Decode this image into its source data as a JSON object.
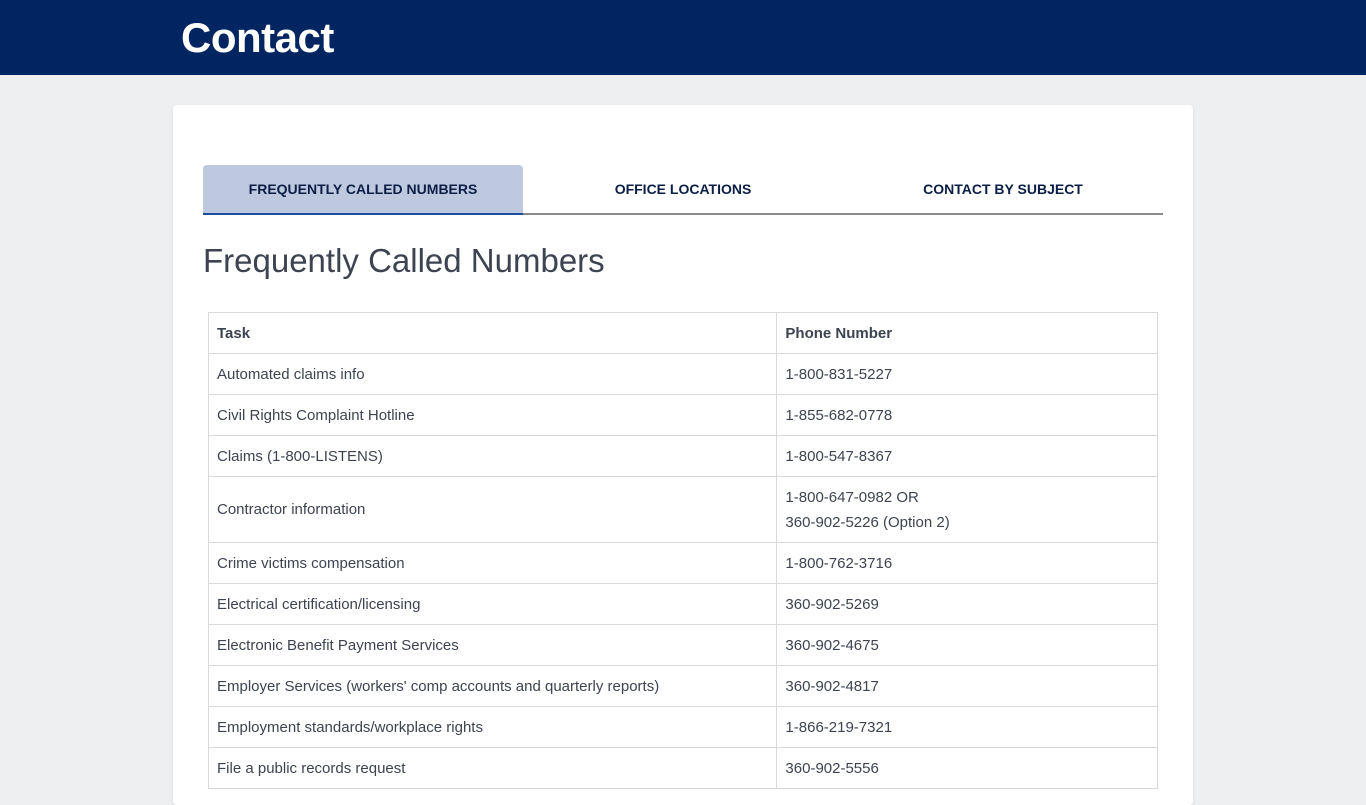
{
  "header": {
    "title": "Contact"
  },
  "tabs": [
    {
      "label": "FREQUENTLY CALLED NUMBERS",
      "active": true
    },
    {
      "label": "OFFICE LOCATIONS",
      "active": false
    },
    {
      "label": "CONTACT BY SUBJECT",
      "active": false
    }
  ],
  "section": {
    "title": "Frequently Called Numbers"
  },
  "table": {
    "headers": [
      "Task",
      "Phone Number"
    ],
    "rows": [
      {
        "task": "Automated claims info",
        "phone": [
          "1-800-831-5227"
        ]
      },
      {
        "task": "Civil Rights Complaint Hotline",
        "phone": [
          "1-855-682-0778"
        ]
      },
      {
        "task": "Claims (1-800-LISTENS)",
        "phone": [
          "1-800-547-8367"
        ]
      },
      {
        "task": "Contractor information",
        "phone": [
          "1-800-647-0982 OR",
          "360-902-5226 (Option 2)"
        ]
      },
      {
        "task": "Crime victims compensation",
        "phone": [
          "1-800-762-3716"
        ]
      },
      {
        "task": "Electrical certification/licensing",
        "phone": [
          "360-902-5269"
        ]
      },
      {
        "task": "Electronic Benefit Payment Services",
        "phone": [
          "360-902-4675"
        ]
      },
      {
        "task": "Employer Services (workers' comp accounts and quarterly reports)",
        "phone": [
          "360-902-4817"
        ]
      },
      {
        "task": "Employment standards/workplace rights",
        "phone": [
          "1-866-219-7321"
        ]
      },
      {
        "task": "File a public records request",
        "phone": [
          "360-902-5556"
        ]
      }
    ]
  },
  "colors": {
    "header_bg": "#002561",
    "page_bg": "#eeeff1",
    "tab_active_bg": "#bec9df",
    "tab_text": "#0b1e46"
  }
}
